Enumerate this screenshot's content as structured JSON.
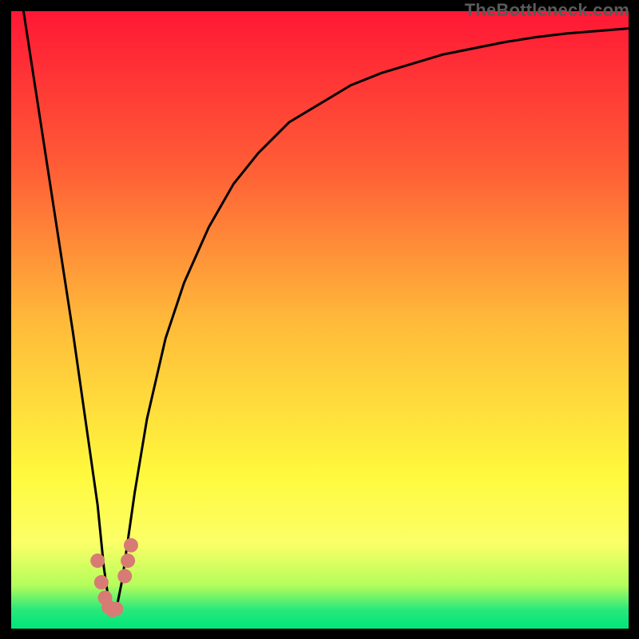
{
  "watermark": "TheBottleneck.com",
  "chart_data": {
    "type": "line",
    "title": "",
    "xlabel": "",
    "ylabel": "",
    "xlim": [
      0,
      100
    ],
    "ylim": [
      0,
      100
    ],
    "series": [
      {
        "name": "bottleneck-curve",
        "x": [
          2,
          4,
          6,
          8,
          10,
          12,
          14,
          15,
          16,
          17,
          18,
          20,
          22,
          25,
          28,
          32,
          36,
          40,
          45,
          50,
          55,
          60,
          65,
          70,
          75,
          80,
          85,
          90,
          95,
          100
        ],
        "values": [
          100,
          87,
          74,
          61,
          48,
          34,
          20,
          10,
          3,
          3,
          8,
          22,
          34,
          47,
          56,
          65,
          72,
          77,
          82,
          85,
          88,
          90,
          91.5,
          93,
          94,
          95,
          95.8,
          96.4,
          96.8,
          97.2
        ]
      }
    ],
    "markers": {
      "name": "highlighted-points",
      "x": [
        14.0,
        14.6,
        15.2,
        15.8,
        16.4,
        17.0,
        18.4,
        18.9,
        19.4
      ],
      "values": [
        11,
        7.5,
        5,
        3.5,
        3,
        3.2,
        8.5,
        11,
        13.5
      ],
      "color": "#d87b74",
      "size": 18
    },
    "curve_stroke": "#000000",
    "gradient_stops": [
      {
        "pos": 0.0,
        "color": "#ff1735"
      },
      {
        "pos": 0.25,
        "color": "#ff5c36"
      },
      {
        "pos": 0.5,
        "color": "#ffb93a"
      },
      {
        "pos": 0.75,
        "color": "#fff93d"
      },
      {
        "pos": 0.86,
        "color": "#fcff67"
      },
      {
        "pos": 0.93,
        "color": "#b4fd5b"
      },
      {
        "pos": 0.97,
        "color": "#27e87c"
      },
      {
        "pos": 1.0,
        "color": "#00e67a"
      }
    ]
  }
}
